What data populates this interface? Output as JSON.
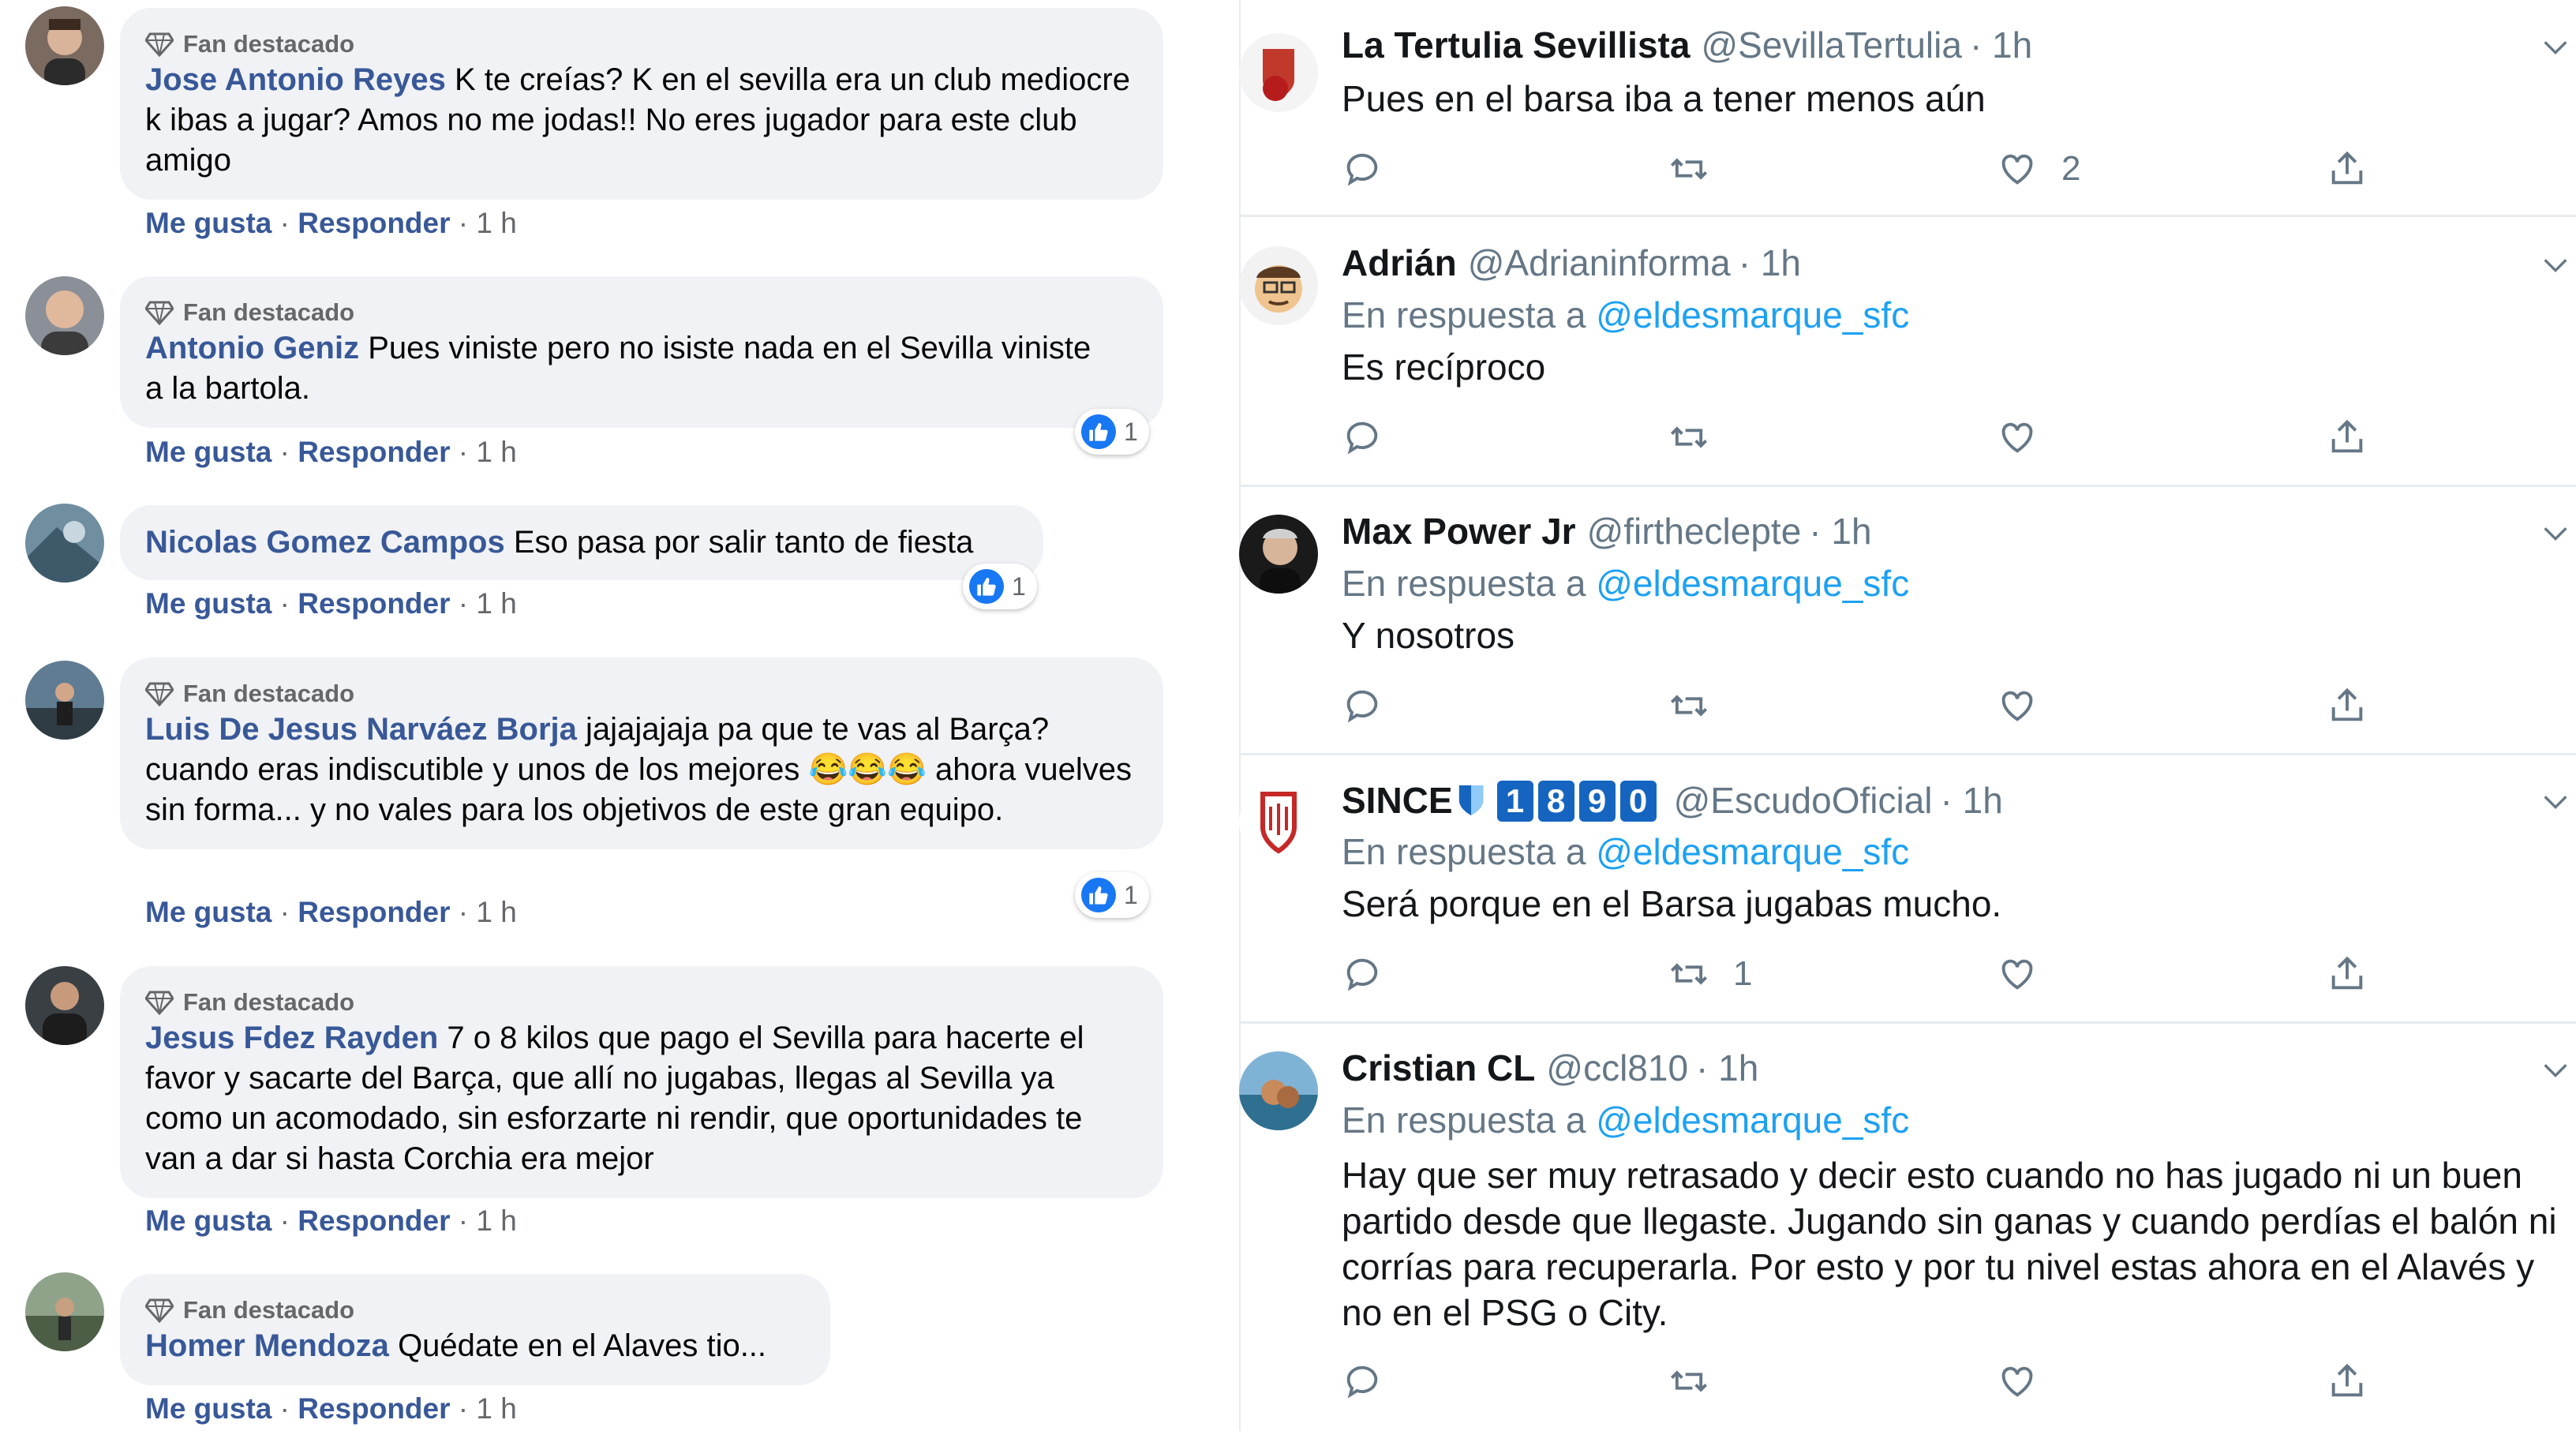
{
  "facebook": {
    "badge_label": "Fan destacado",
    "action_like": "Me gusta",
    "action_reply": "Responder",
    "separator": "·",
    "comments": [
      {
        "author": "Jose Antonio Reyes",
        "text": "K te creías? K en el sevilla era un club mediocre k ibas a jugar? Amos no me jodas!! No eres jugador para este club amigo",
        "time": "1 h",
        "badge": true
      },
      {
        "author": "Antonio Geniz",
        "text": "Pues viniste pero no isiste nada en el Sevilla viniste a la bartola.",
        "time": "1 h",
        "badge": true,
        "reactions": "1"
      },
      {
        "author": "Nicolas Gomez Campos",
        "text": "Eso pasa por salir tanto de fiesta",
        "time": "1 h",
        "badge": false,
        "reactions": "1"
      },
      {
        "author": "Luis De Jesus Narváez Borja",
        "text": "jajajajaja pa que te vas al Barça? cuando eras indiscutible y unos de los mejores 😂😂😂 ahora vuelves sin forma... y no vales para los objetivos de este gran equipo.",
        "time": "1 h",
        "badge": true,
        "reactions": "1"
      },
      {
        "author": "Jesus Fdez Rayden",
        "text": "7 o 8 kilos que pago el Sevilla para hacerte el favor y sacarte del Barça, que allí no jugabas, llegas al Sevilla ya como un acomodado, sin esforzarte ni rendir, que oportunidades te van a dar si hasta Corchia era mejor",
        "time": "1 h",
        "badge": true
      },
      {
        "author": "Homer Mendoza",
        "text": "Quédate en el Alaves tio...",
        "time": "1 h",
        "badge": true
      }
    ]
  },
  "twitter": {
    "replying_prefix": "En respuesta a",
    "tweets": [
      {
        "name": "La Tertulia Sevillista",
        "handle": "@SevillaTertulia",
        "time": "· 1h",
        "reply_to": "",
        "text": "Pues en el barsa iba a tener menos aún",
        "retweets": "",
        "likes": "2"
      },
      {
        "name": "Adrián",
        "handle": "@Adrianinforma",
        "time": "· 1h",
        "reply_to": "@eldesmarque_sfc",
        "text": "Es recíproco",
        "retweets": "",
        "likes": ""
      },
      {
        "name": "Max Power Jr",
        "handle": "@firtheclepte",
        "time": "· 1h",
        "reply_to": "@eldesmarque_sfc",
        "text": "Y nosotros",
        "retweets": "",
        "likes": ""
      },
      {
        "name": "SINCE",
        "name_badges": [
          "1",
          "8",
          "9",
          "0"
        ],
        "handle": "@EscudoOficial",
        "time": "· 1h",
        "reply_to": "@eldesmarque_sfc",
        "text": "Será porque en el Barsa jugabas mucho.",
        "retweets": "1",
        "likes": ""
      },
      {
        "name": "Cristian CL",
        "handle": "@ccl810",
        "time": "· 1h",
        "reply_to": "@eldesmarque_sfc",
        "text": "Hay que ser muy retrasado y decir esto cuando no has jugado ni un buen partido desde que llegaste. Jugando sin ganas y cuando perdías el balón ni corrías para recuperarla. Por esto y por tu nivel estas ahora en el Alavés y no en el PSG o City.",
        "retweets": "",
        "likes": ""
      }
    ]
  },
  "colors": {
    "fb_link": "#385898",
    "fb_bubble": "#f0f2f5",
    "fb_meta": "#65676b",
    "fb_like_blue": "#1877f2",
    "tw_blue": "#1da1f2",
    "tw_meta": "#657786",
    "tw_divider": "#e6ecf0",
    "since_badge_blue": "#1565c0"
  },
  "icons": {
    "badge": "diamond-icon",
    "like_reaction": "thumbs-up-icon",
    "tweet_actions": [
      "reply-icon",
      "retweet-icon",
      "like-heart-icon",
      "share-icon"
    ],
    "menu": "chevron-down-icon",
    "since_name": "shield-icon"
  }
}
